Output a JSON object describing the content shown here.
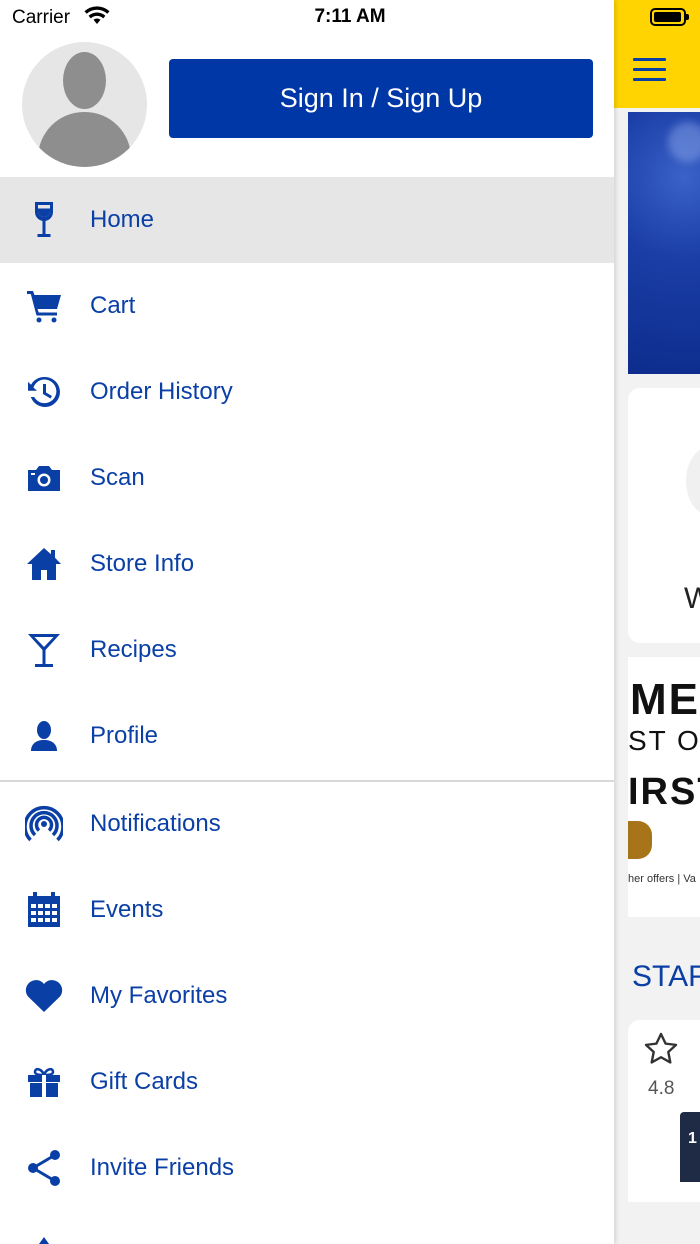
{
  "status_bar": {
    "carrier": "Carrier",
    "time": "7:11 AM"
  },
  "drawer": {
    "sign_in_label": "Sign In / Sign Up",
    "menu": [
      {
        "id": "home",
        "label": "Home",
        "icon": "wine-glass-icon",
        "active": true
      },
      {
        "id": "cart",
        "label": "Cart",
        "icon": "cart-icon"
      },
      {
        "id": "order-history",
        "label": "Order History",
        "icon": "history-icon"
      },
      {
        "id": "scan",
        "label": "Scan",
        "icon": "camera-icon"
      },
      {
        "id": "store-info",
        "label": "Store Info",
        "icon": "home-icon"
      },
      {
        "id": "recipes",
        "label": "Recipes",
        "icon": "cocktail-icon"
      },
      {
        "id": "profile",
        "label": "Profile",
        "icon": "person-icon"
      },
      {
        "id": "notifications",
        "label": "Notifications",
        "icon": "broadcast-icon"
      },
      {
        "id": "events",
        "label": "Events",
        "icon": "calendar-icon"
      },
      {
        "id": "my-favorites",
        "label": "My Favorites",
        "icon": "heart-icon"
      },
      {
        "id": "gift-cards",
        "label": "Gift Cards",
        "icon": "gift-icon"
      },
      {
        "id": "invite-friends",
        "label": "Invite Friends",
        "icon": "share-icon"
      }
    ]
  },
  "background": {
    "card_partial_text": "W",
    "promo_lines": [
      "ME",
      "ST O",
      "IRST",
      "her offers | Va"
    ],
    "section_title_partial": "STAF",
    "product_rating": "4.8"
  },
  "colors": {
    "accent": "#0a3fa6",
    "button": "#0037a6",
    "header": "#ffd400",
    "active_row": "#e6e6e6"
  }
}
